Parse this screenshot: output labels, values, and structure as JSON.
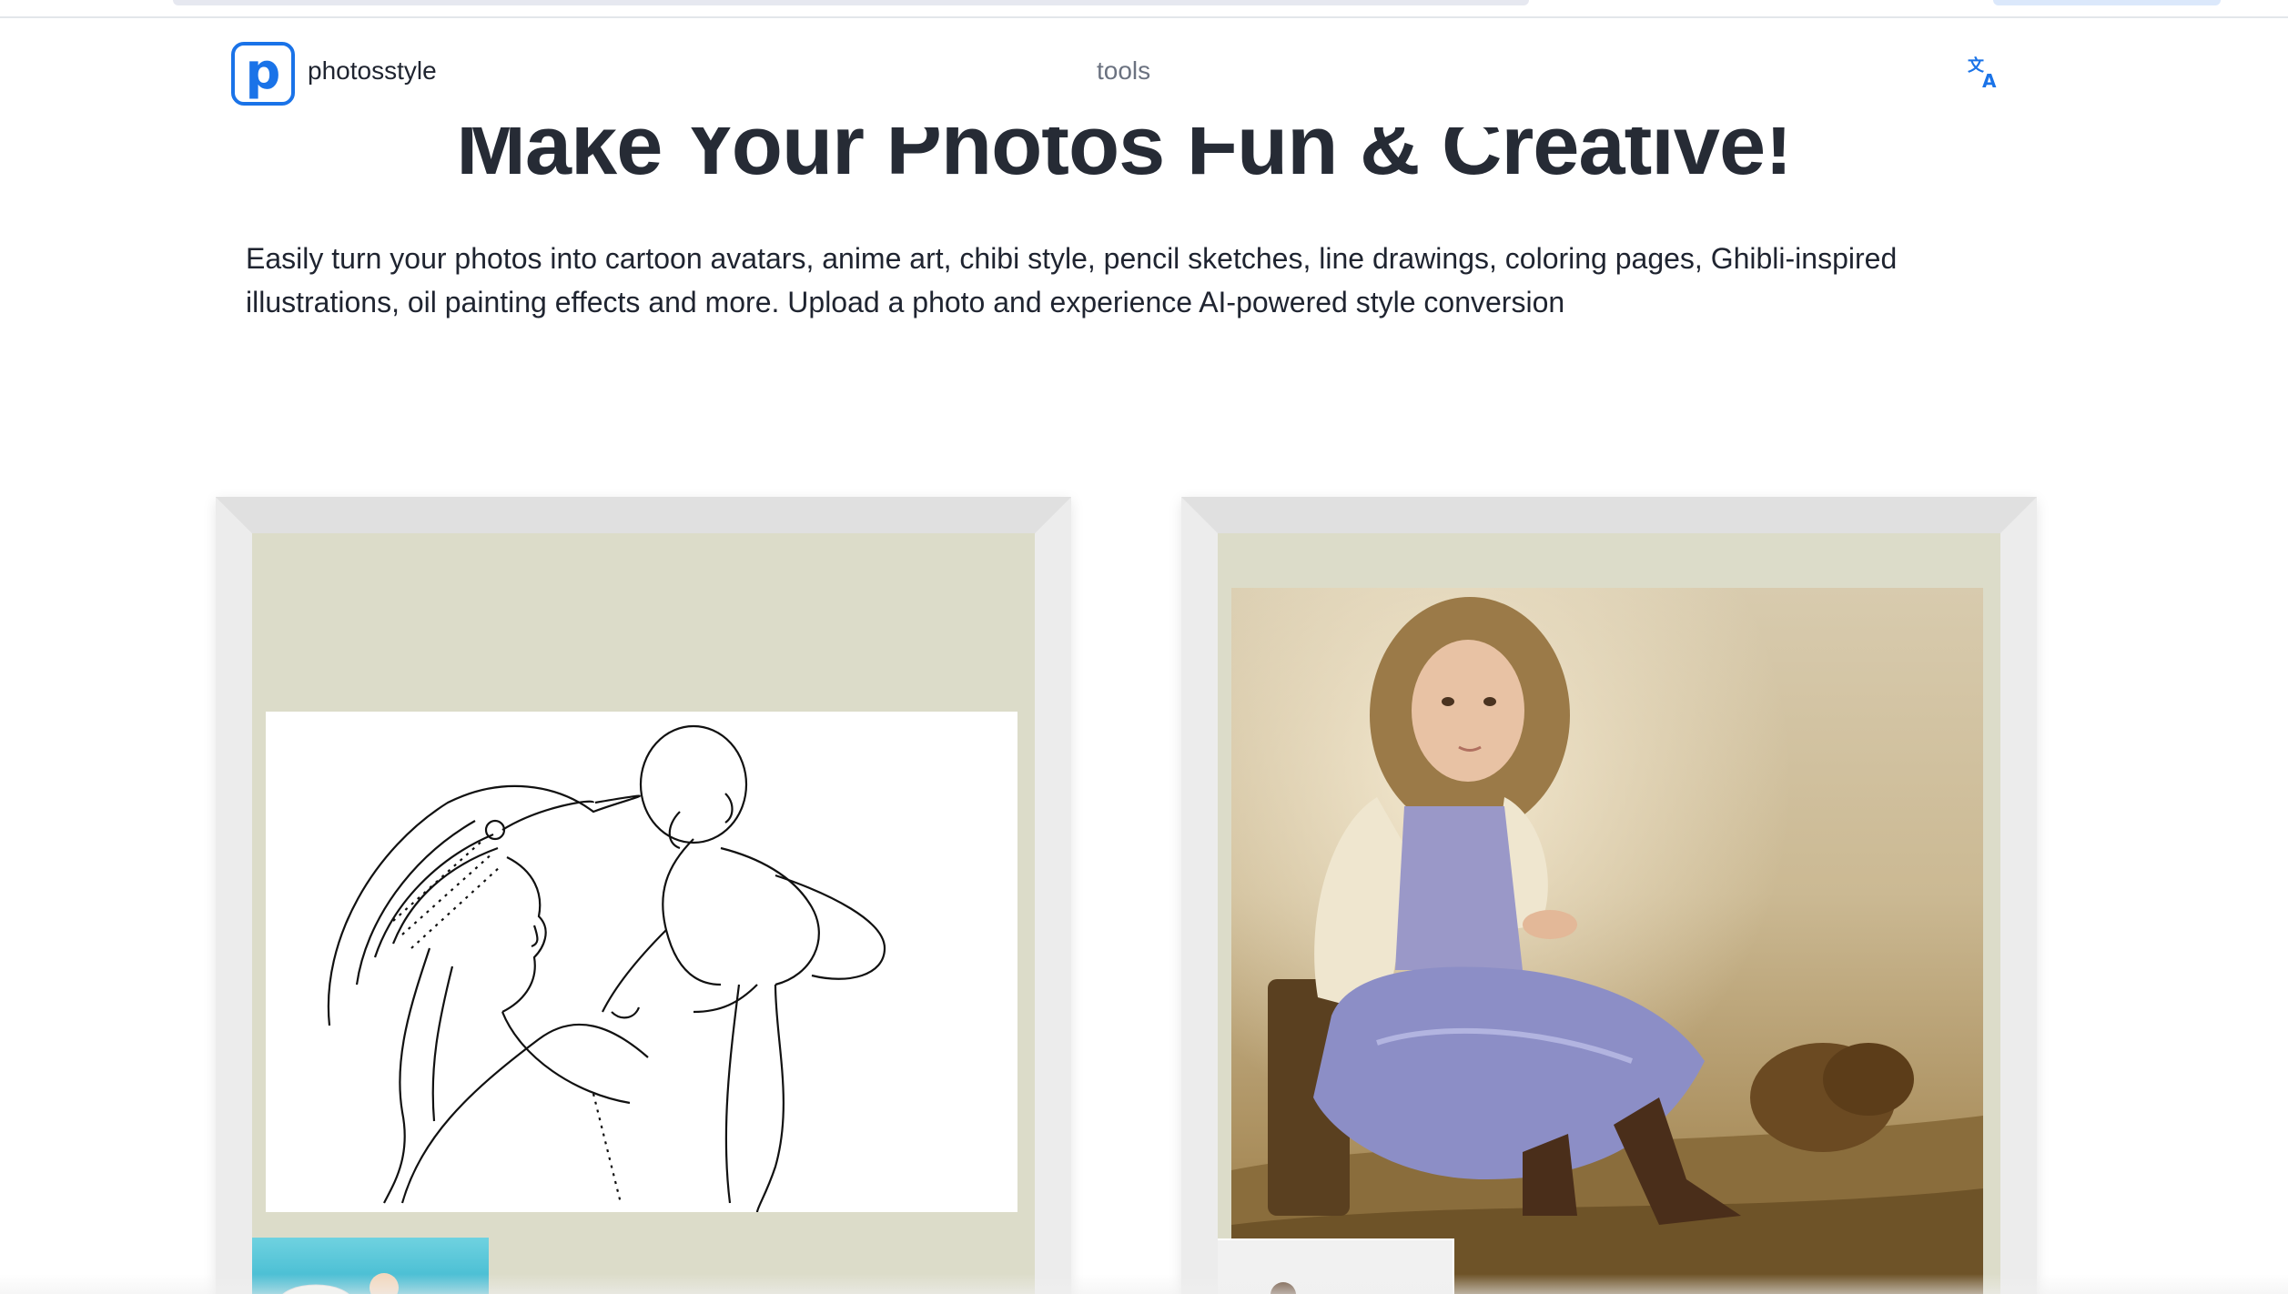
{
  "header": {
    "brand": "photosstyle",
    "logo_letter": "p",
    "nav_tools": "tools",
    "language_icon": "translate-icon"
  },
  "hero": {
    "title": "Make Your Photos Fun & Creative!",
    "description": "Easily turn your photos into cartoon avatars, anime art, chibi style, pencil sketches, line drawings, coloring pages, Ghibli-inspired illustrations, oil painting effects and more. Upload a photo and experience AI-powered style conversion"
  },
  "colors": {
    "accent": "#1a73e8",
    "title": "#262b35",
    "nav": "#6b7280",
    "mat": "#dcdcc9",
    "frame": "#ececec"
  }
}
